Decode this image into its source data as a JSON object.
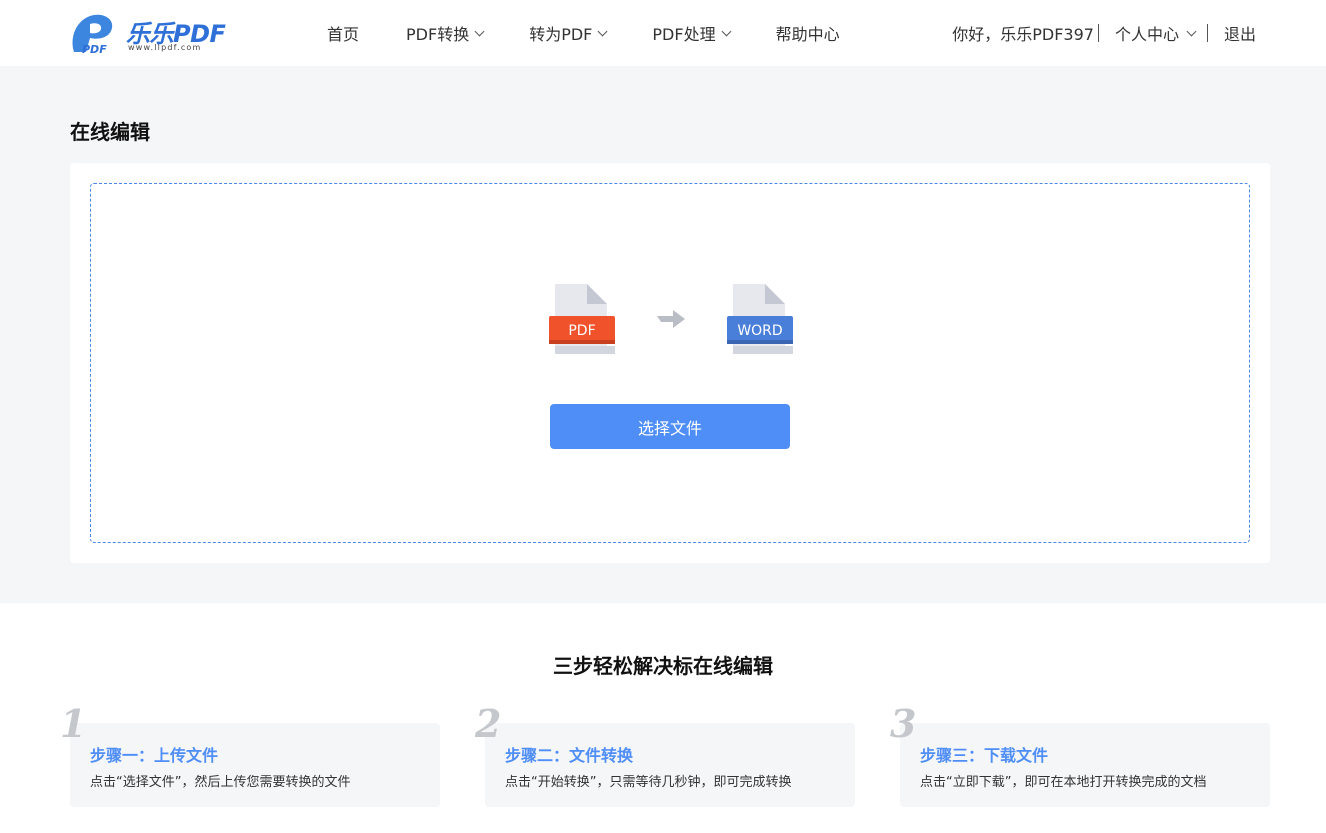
{
  "header": {
    "logo": {
      "brand": "乐乐PDF",
      "url_text": "www.llpdf.com"
    },
    "nav": [
      {
        "label": "首页",
        "has_dropdown": false
      },
      {
        "label": "PDF转换",
        "has_dropdown": true
      },
      {
        "label": "转为PDF",
        "has_dropdown": true
      },
      {
        "label": "PDF处理",
        "has_dropdown": true
      },
      {
        "label": "帮助中心",
        "has_dropdown": false
      }
    ],
    "user": {
      "greeting": "你好，乐乐PDF397",
      "user_center": "个人中心",
      "logout": "退出"
    }
  },
  "main": {
    "title": "在线编辑",
    "source_format": "PDF",
    "target_format": "WORD",
    "select_button": "选择文件"
  },
  "steps": {
    "title": "三步轻松解决标在线编辑",
    "items": [
      {
        "num": "1",
        "title": "步骤一：上传文件",
        "desc": "点击“选择文件”，然后上传您需要转换的文件"
      },
      {
        "num": "2",
        "title": "步骤二：文件转换",
        "desc": "点击“开始转换”，只需等待几秒钟，即可完成转换"
      },
      {
        "num": "3",
        "title": "步骤三：下载文件",
        "desc": "点击“立即下载”，即可在本地打开转换完成的文档"
      }
    ]
  },
  "colors": {
    "accent": "#4f8ef7",
    "pdf_badge": "#f0532b",
    "word_badge": "#4a7fd9",
    "background": "#f5f6f8"
  }
}
